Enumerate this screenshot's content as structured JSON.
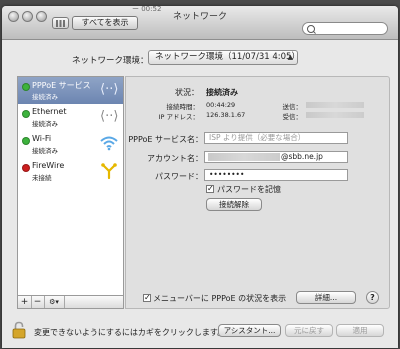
{
  "window": {
    "title": "ネットワーク",
    "show_all": "すべてを表示",
    "top_info": "ー 00:52"
  },
  "location": {
    "label": "ネットワーク環境：",
    "value": "ネットワーク環境（11/07/31 4:05）"
  },
  "services": [
    {
      "name": "PPPoE サービス",
      "status": "接続済み",
      "color": "#3db33d",
      "icon": "dual-arrow-icon",
      "selected": true
    },
    {
      "name": "Ethernet",
      "status": "接続済み",
      "color": "#3db33d",
      "icon": "dual-arrow-icon",
      "selected": false
    },
    {
      "name": "Wi-Fi",
      "status": "接続済み",
      "color": "#3db33d",
      "icon": "wifi-icon",
      "selected": false
    },
    {
      "name": "FireWire",
      "status": "未接続",
      "color": "#cc1f1f",
      "icon": "firewire-icon",
      "selected": false
    }
  ],
  "sidebar_buttons": {
    "add": "+",
    "remove": "−",
    "gear": "⚙▾"
  },
  "details": {
    "status_label": "状況：",
    "status_value": "接続済み",
    "time_label": "接続時間：",
    "time_value": "00:44:29",
    "ip_label": "IP アドレス：",
    "ip_value": "126.38.1.67",
    "sent_label": "送信：",
    "recv_label": "受信："
  },
  "form": {
    "service_label": "PPPoE サービス名：",
    "service_placeholder": "ISP より提供（必要な場合）",
    "account_label": "アカウント名：",
    "account_suffix": "@sbb.ne.jp",
    "password_label": "パスワード：",
    "password_value": "••••••••",
    "remember_label": "パスワードを記憶",
    "disconnect_button": "接続解除"
  },
  "bottom": {
    "menubar_checkbox": "メニューバーに PPPoE の状況を表示",
    "details_button": "詳細...",
    "help": "?"
  },
  "footer": {
    "lock_text": "変更できないようにするにはカギをクリックします。",
    "assistant_button": "アシスタント...",
    "revert_button": "元に戻す",
    "apply_button": "適用"
  }
}
